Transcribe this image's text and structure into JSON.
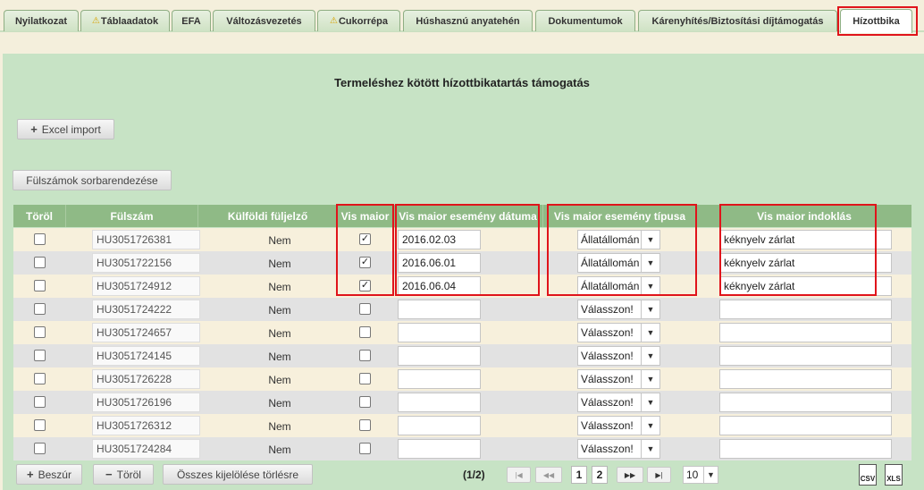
{
  "tabs": [
    {
      "label": "Nyilatkozat",
      "warn": false
    },
    {
      "label": "Táblaadatok",
      "warn": true
    },
    {
      "label": "EFA",
      "warn": false
    },
    {
      "label": "Változásvezetés",
      "warn": false
    },
    {
      "label": "Cukorrépa",
      "warn": true
    },
    {
      "label": "Húshasznú anyatehén",
      "warn": false
    },
    {
      "label": "Dokumentumok",
      "warn": false
    },
    {
      "label": "Kárenyhítés/Biztosítási díjtámogatás",
      "warn": false
    },
    {
      "label": "Hízottbika",
      "warn": false,
      "active": true
    }
  ],
  "page": {
    "title": "Termeléshez kötött hízottbikatartás támogatás",
    "excel_import": "Excel import",
    "sort_button": "Fülszámok sorbarendezése"
  },
  "table": {
    "headers": {
      "delete": "Töröl",
      "ear_tag": "Fülszám",
      "foreign": "Külföldi füljelző",
      "vis_maior": "Vis maior",
      "event_date": "Vis maior esemény dátuma",
      "event_type": "Vis maior esemény típusa",
      "reason": "Vis maior indoklás"
    },
    "rows": [
      {
        "ear": "HU3051726381",
        "foreign": "Nem",
        "vis": true,
        "date": "2016.02.03",
        "type": "Állatállomán",
        "reason": "kéknyelv zárlat"
      },
      {
        "ear": "HU3051722156",
        "foreign": "Nem",
        "vis": true,
        "date": "2016.06.01",
        "type": "Állatállomán",
        "reason": "kéknyelv zárlat"
      },
      {
        "ear": "HU3051724912",
        "foreign": "Nem",
        "vis": true,
        "date": "2016.06.04",
        "type": "Állatállomán",
        "reason": "kéknyelv zárlat"
      },
      {
        "ear": "HU3051724222",
        "foreign": "Nem",
        "vis": false,
        "date": "",
        "type": "Válasszon!",
        "reason": ""
      },
      {
        "ear": "HU3051724657",
        "foreign": "Nem",
        "vis": false,
        "date": "",
        "type": "Válasszon!",
        "reason": ""
      },
      {
        "ear": "HU3051724145",
        "foreign": "Nem",
        "vis": false,
        "date": "",
        "type": "Válasszon!",
        "reason": ""
      },
      {
        "ear": "HU3051726228",
        "foreign": "Nem",
        "vis": false,
        "date": "",
        "type": "Válasszon!",
        "reason": ""
      },
      {
        "ear": "HU3051726196",
        "foreign": "Nem",
        "vis": false,
        "date": "",
        "type": "Válasszon!",
        "reason": ""
      },
      {
        "ear": "HU3051726312",
        "foreign": "Nem",
        "vis": false,
        "date": "",
        "type": "Válasszon!",
        "reason": ""
      },
      {
        "ear": "HU3051724284",
        "foreign": "Nem",
        "vis": false,
        "date": "",
        "type": "Válasszon!",
        "reason": ""
      }
    ]
  },
  "footer": {
    "insert": "Beszúr",
    "delete": "Töröl",
    "clear_selection": "Összes kijelölése törlésre",
    "page_info": "(1/2)",
    "pages": [
      "1",
      "2"
    ],
    "page_size": "10",
    "csv": "CSV",
    "xls": "XLS"
  },
  "colors": {
    "highlight": "#e0141b",
    "header_bg": "#8fba86",
    "panel_bg": "#c7e3c5"
  }
}
